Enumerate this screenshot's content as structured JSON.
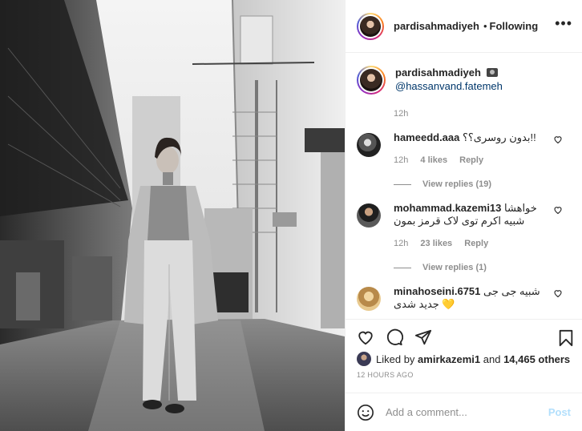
{
  "header": {
    "username": "pardisahmadiyeh",
    "separator": "•",
    "follow_status": "Following",
    "more": "•••"
  },
  "caption": {
    "username": "pardisahmadiyeh",
    "camera_icon": "camera-icon",
    "mention": "@hassanvand.fatemeh",
    "time": "12h"
  },
  "comments": [
    {
      "username": "hameedd.aaa",
      "text": "بدون روسری؟؟!!",
      "time": "12h",
      "likes": "4 likes",
      "reply": "Reply",
      "view_replies": "View replies (19)",
      "avatar_color": "#6b6b6b"
    },
    {
      "username": "mohammad.kazemi13",
      "text": "خواهشا شبیه اکرم توی لاک قرمز بمون",
      "time": "12h",
      "likes": "23 likes",
      "reply": "Reply",
      "view_replies": "View replies (1)",
      "avatar_color": "#4a3f3a"
    },
    {
      "username": "minahoseini.6751",
      "text": "شبیه جی جی جدید شدی 💛",
      "avatar_color": "#c9a46a"
    }
  ],
  "actions": {
    "like_icon": "heart-icon",
    "comment_icon": "comment-icon",
    "share_icon": "share-icon",
    "save_icon": "bookmark-icon"
  },
  "liked_by": {
    "prefix": "Liked by",
    "user": "amirkazemi1",
    "joiner": "and",
    "others": "14,465 others"
  },
  "post_time": "12 HOURS AGO",
  "add_comment": {
    "placeholder": "Add a comment...",
    "post_label": "Post"
  },
  "colors": {
    "link": "#00376b",
    "muted": "#8e8e8e",
    "post_button_disabled": "#b2dffc"
  }
}
